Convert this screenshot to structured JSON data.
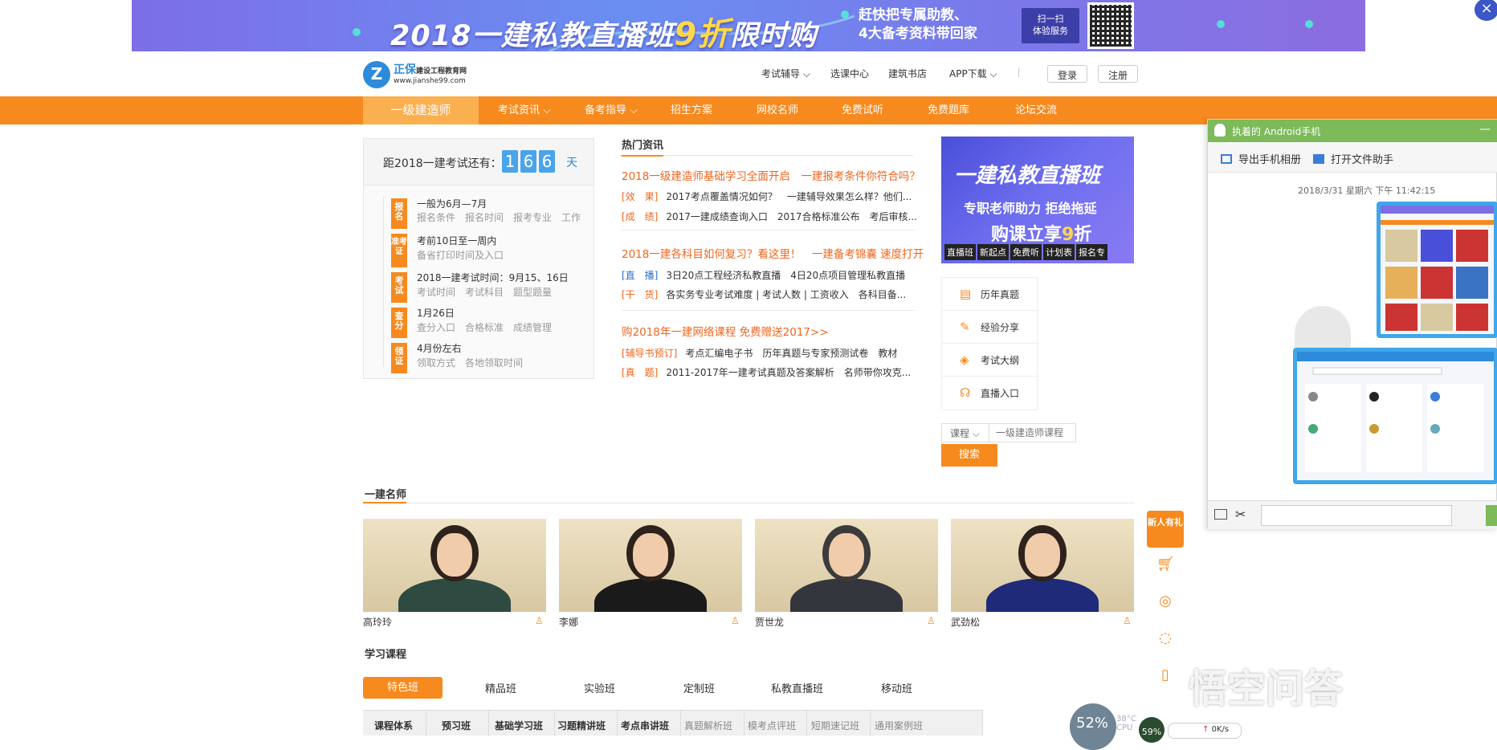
{
  "banner": {
    "title_a": "2018一建私教直播班",
    "title_b": "9折",
    "title_c": "限时购",
    "sub_1": "赶快把专属助教、",
    "sub_2": "4大备考资料带回家",
    "scan_1": "扫一扫",
    "scan_2": "体验服务",
    "close": "×"
  },
  "logo": {
    "mark": "Z",
    "name": "正保",
    "sub": "建设工程教育网",
    "url": "www.jianshe99.com"
  },
  "toplinks": [
    "考试辅导",
    "选课中心",
    "建筑书店",
    "APP下载"
  ],
  "top_buttons": {
    "login": "登录",
    "register": "注册"
  },
  "nav": [
    "一级建造师",
    "考试资讯",
    "备考指导",
    "招生方案",
    "网校名师",
    "免费试听",
    "免费题库",
    "论坛交流"
  ],
  "countdown": {
    "label": "距2018一建考试还有：",
    "digits": [
      "1",
      "6",
      "6"
    ],
    "unit": "天",
    "steps": [
      {
        "badge": "报名",
        "title": "一般为6月—7月",
        "sub": "报名条件　报名时间　报考专业　工作"
      },
      {
        "badge": "准考证",
        "title": "考前10日至一周内",
        "sub": "备省打印时间及入口"
      },
      {
        "badge": "考试",
        "title": "2018一建考试时间：9月15、16日",
        "sub": "考试时间　考试科目　题型题量"
      },
      {
        "badge": "查分",
        "title": "1月26日",
        "sub": "查分入口　合格标准　成绩管理"
      },
      {
        "badge": "领证",
        "title": "4月份左右",
        "sub": "领取方式　各地领取时间"
      }
    ]
  },
  "news": {
    "section": "热门资讯",
    "groups": [
      {
        "headline": "2018一级建造师基础学习全面开启　一建报考条件你符合吗？",
        "rows": [
          {
            "tag": "[效　果]",
            "text": "2017考点覆盖情况如何？　一建辅导效果怎么样？他们..."
          },
          {
            "tag": "[成　绩]",
            "text": "2017一建成绩查询入口　2017合格标准公布　考后审核..."
          }
        ]
      },
      {
        "headline": "2018一建各科目如何复习？看这里！　一建备考锦囊 速度打开",
        "rows": [
          {
            "tag": "[直　播]",
            "text": "3日20点工程经济私教直播　4日20点项目管理私教直播"
          },
          {
            "tag": "[干　货]",
            "text": "各实务专业考试难度 | 考试人数 | 工资收入　各科目备..."
          }
        ]
      },
      {
        "headline": "购2018年一建网络课程 免费赠送2017>>",
        "rows": [
          {
            "tag": "[辅导书预订]",
            "text": "考点汇编电子书　历年真题与专家预测试卷　教材"
          },
          {
            "tag": "[真　题]",
            "text": "2011-2017年一建考试真题及答案解析　名师带你攻克..."
          }
        ]
      }
    ]
  },
  "ad": {
    "line1": "一建私教直播班",
    "line2": "专职老师助力 拒绝拖延",
    "line3a": "购课立享",
    "line3b": "9",
    "line3c": "折",
    "tags": [
      "直播班",
      "新起点",
      "免费听",
      "计划表",
      "报名专"
    ]
  },
  "sidelinks": [
    {
      "label": "历年真题",
      "icon": "document-icon"
    },
    {
      "label": "经验分享",
      "icon": "edit-icon"
    },
    {
      "label": "考试大纲",
      "icon": "layers-icon"
    },
    {
      "label": "直播入口",
      "icon": "headphones-icon"
    }
  ],
  "search": {
    "select": "课程",
    "placeholder": "一级建造师课程",
    "button": "搜索"
  },
  "teachers": {
    "section": "一建名师",
    "items": [
      {
        "name": "高玲玲"
      },
      {
        "name": "李娜"
      },
      {
        "name": "贾世龙"
      },
      {
        "name": "武劲松"
      }
    ]
  },
  "courses": {
    "section": "学习课程",
    "tabs": [
      "特色班",
      "精品班",
      "实验班",
      "定制班",
      "私教直播班",
      "移动班"
    ],
    "headers": [
      "课程体系",
      "预习班",
      "基础学习班",
      "习题精讲班",
      "考点串讲班",
      "真题解析班",
      "模考点评班",
      "短期速记班",
      "通用案例班"
    ]
  },
  "float": {
    "gift": "新人有礼"
  },
  "chat": {
    "title": "执着的 Android手机",
    "min": "—",
    "tool_export": "导出手机相册",
    "tool_open": "打开文件助手",
    "time": "2018/3/31 星期六 下午 11:42:15"
  },
  "watermark": "悟空问答",
  "widgets": {
    "gauge": "52%",
    "gauge_small": "59%",
    "temp": "38°C",
    "temp_label": "CPU",
    "net": "0K/s"
  },
  "colors": {
    "brand_orange": "#f68a1e",
    "link_blue": "#2d8bd9",
    "chat_green": "#7cba5a"
  }
}
